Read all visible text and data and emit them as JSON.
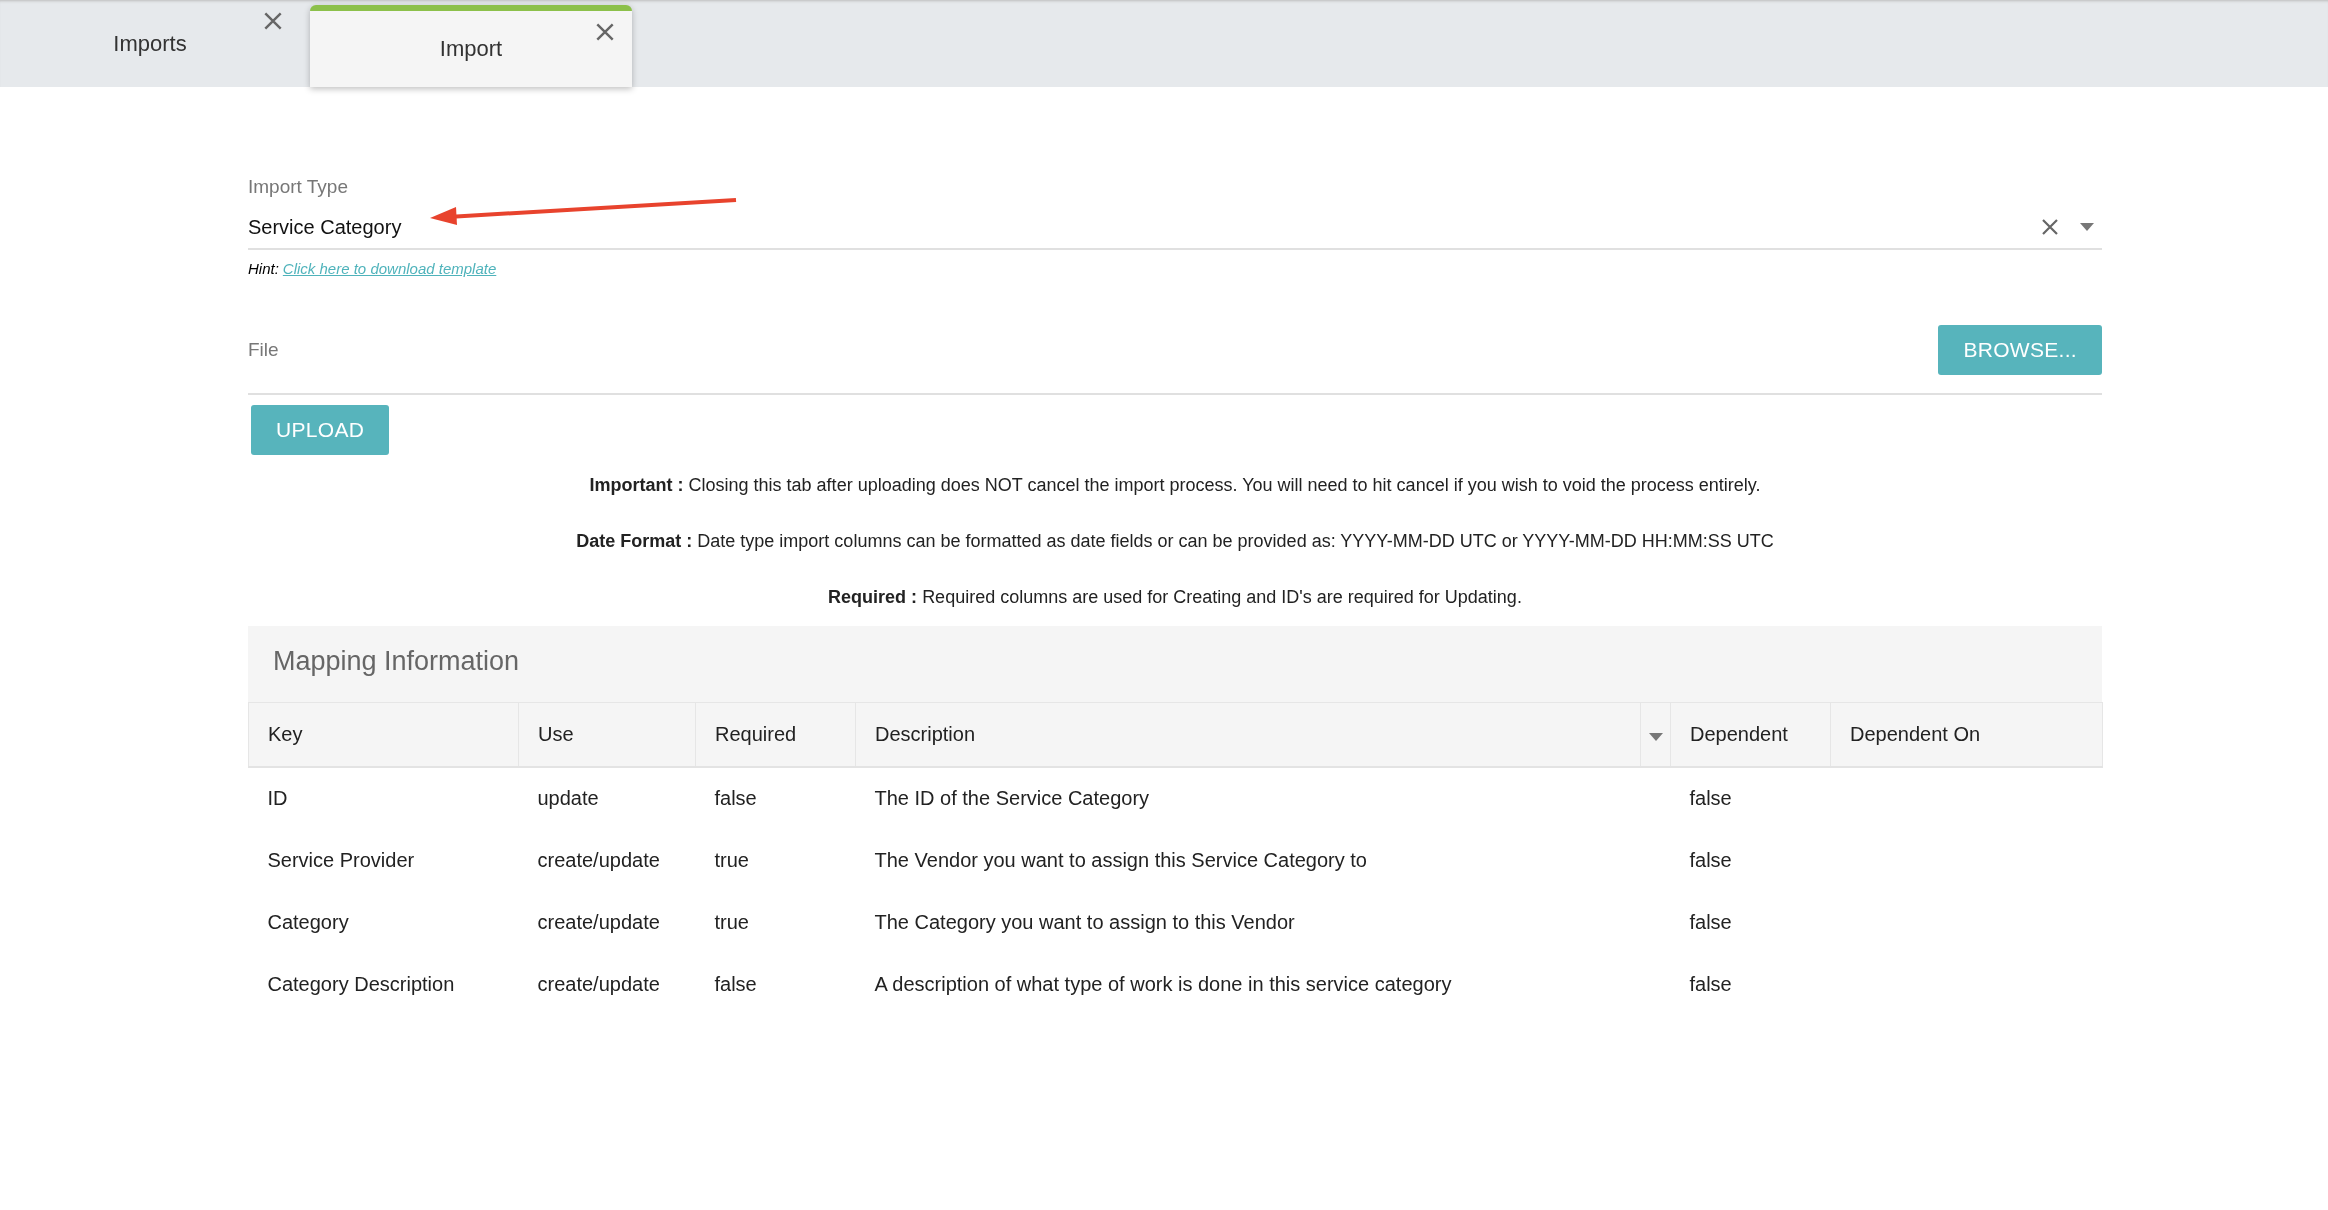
{
  "tabs": [
    {
      "label": "Imports",
      "selected": false
    },
    {
      "label": "Import",
      "selected": true
    }
  ],
  "import_type": {
    "label": "Import Type",
    "value": "Service Category"
  },
  "hint": {
    "label": "Hint:",
    "link": "Click here to download template"
  },
  "file": {
    "label": "File",
    "browse": "BROWSE..."
  },
  "upload": "UPLOAD",
  "notes": [
    {
      "label": "Important :",
      "text": "Closing this tab after uploading does NOT cancel the import process. You will need to hit cancel if you wish to void the process entirely."
    },
    {
      "label": "Date Format :",
      "text": "Date type import columns can be formatted as date fields or can be provided as: YYYY-MM-DD UTC or YYYY-MM-DD HH:MM:SS UTC"
    },
    {
      "label": "Required :",
      "text": "Required columns are used for Creating and ID's are required for Updating."
    }
  ],
  "mapping": {
    "title": "Mapping Information",
    "columns": [
      "Key",
      "Use",
      "Required",
      "Description",
      "Dependent",
      "Dependent On"
    ],
    "rows": [
      [
        "ID",
        "update",
        "false",
        "The ID of the Service Category",
        "false",
        ""
      ],
      [
        "Service Provider",
        "create/update",
        "true",
        "The Vendor you want to assign this Service Category to",
        "false",
        ""
      ],
      [
        "Category",
        "create/update",
        "true",
        "The Category you want to assign to this Vendor",
        "false",
        ""
      ],
      [
        "Category Description",
        "create/update",
        "false",
        "A description of what type of work is done in this service category",
        "false",
        ""
      ]
    ]
  }
}
